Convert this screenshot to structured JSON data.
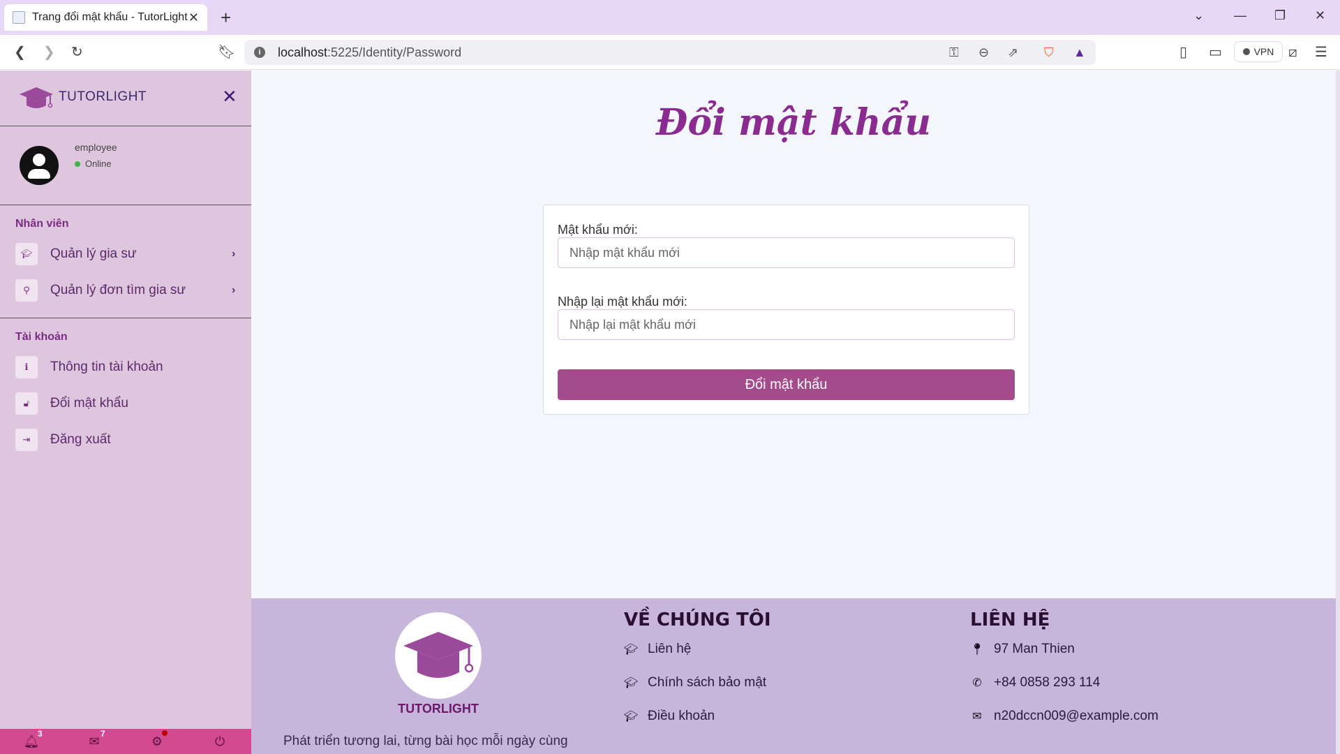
{
  "browser": {
    "tab_title": "Trang đổi mật khẩu - TutorLight",
    "url_host": "localhost",
    "url_path": ":5225/Identity/Password",
    "vpn_label": "VPN"
  },
  "sidebar": {
    "brand": "TUTORLIGHT",
    "user": {
      "name": "employee",
      "status": "Online"
    },
    "sections": [
      {
        "title": "Nhân viên",
        "items": [
          {
            "label": "Quản lý gia sư",
            "icon": "graduation-cap-icon"
          },
          {
            "label": "Quản lý đơn tìm gia sư",
            "icon": "search-icon"
          }
        ]
      },
      {
        "title": "Tài khoản",
        "items": [
          {
            "label": "Thông tin tài khoản",
            "icon": "info-icon"
          },
          {
            "label": "Đổi mật khẩu",
            "icon": "unlock-icon"
          },
          {
            "label": "Đăng xuất",
            "icon": "sign-out-icon"
          }
        ]
      }
    ],
    "bottom": {
      "notifications": "3",
      "messages": "7"
    }
  },
  "main": {
    "title": "Đổi mật khẩu",
    "form": {
      "new_password_label": "Mật khẩu mới:",
      "new_password_placeholder": "Nhập mật khẩu mới",
      "confirm_label": "Nhập lại mật khẩu mới:",
      "confirm_placeholder": "Nhập lại mật khẩu mới",
      "submit_label": "Đổi mật khẩu"
    }
  },
  "footer": {
    "brand": "TUTORLIGHT",
    "tagline": "Phát triển tương lai, từng bài học mỗi ngày cùng",
    "about": {
      "title": "VỀ CHÚNG TÔI",
      "links": [
        "Liên hệ",
        "Chính sách bảo mật",
        "Điều khoản"
      ]
    },
    "contact": {
      "title": "LIÊN HỆ",
      "address": "97 Man Thien",
      "phone": "+84 0858 293 114",
      "email": "n20dccn009@example.com"
    }
  },
  "colors": {
    "accent": "#a44b8b",
    "sidebar": "#dfc6df",
    "footer": "#c8b5dc",
    "title": "#8a2c8f"
  }
}
